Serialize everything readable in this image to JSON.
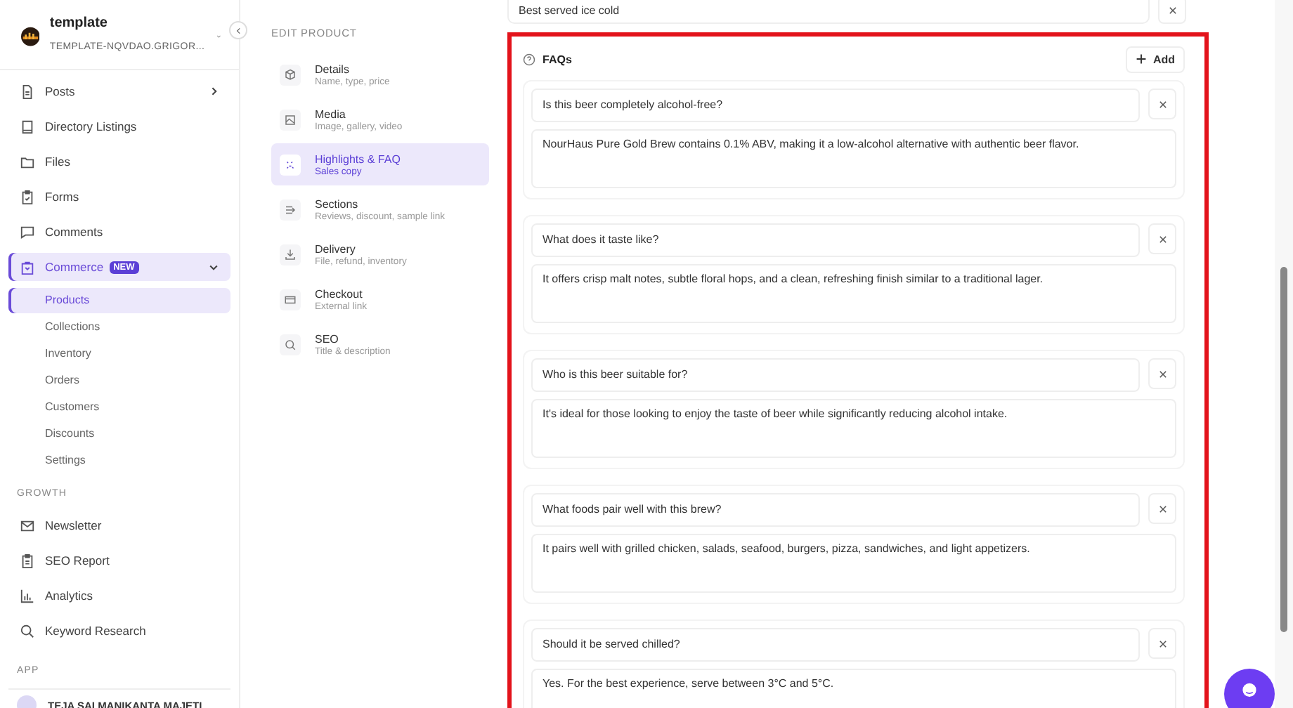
{
  "workspace": {
    "name": "template",
    "domain": "TEMPLATE-NQVDAO.GRIGOR..."
  },
  "sidebar": {
    "items": [
      {
        "label": "Posts",
        "selected": false,
        "expanded": false
      },
      {
        "label": "Directory Listings",
        "selected": false
      },
      {
        "label": "Files",
        "selected": false
      },
      {
        "label": "Forms",
        "selected": false
      },
      {
        "label": "Comments",
        "selected": false
      },
      {
        "label": "Commerce",
        "badge": "NEW",
        "selected": true,
        "expanded": true,
        "children": [
          {
            "label": "Products",
            "selected": true
          },
          {
            "label": "Collections",
            "selected": false
          },
          {
            "label": "Inventory",
            "selected": false
          },
          {
            "label": "Orders",
            "selected": false
          },
          {
            "label": "Customers",
            "selected": false
          },
          {
            "label": "Discounts",
            "selected": false
          },
          {
            "label": "Settings",
            "selected": false
          }
        ]
      }
    ],
    "growth": {
      "title": "GROWTH",
      "items": [
        {
          "label": "Newsletter",
          "selected": false
        },
        {
          "label": "SEO Report",
          "selected": false
        },
        {
          "label": "Analytics",
          "selected": false
        },
        {
          "label": "Keyword Research",
          "selected": false
        }
      ]
    },
    "app": {
      "title": "APP",
      "user": "TEJA SAI MANIKANTA MAJETI"
    }
  },
  "product_nav": {
    "title": "EDIT PRODUCT",
    "items": [
      {
        "label": "Details",
        "sublabel": "Name, type, price",
        "selected": false
      },
      {
        "label": "Media",
        "sublabel": "Image, gallery, video",
        "selected": false
      },
      {
        "label": "Highlights & FAQ",
        "sublabel": "Sales copy",
        "selected": true
      },
      {
        "label": "Sections",
        "sublabel": "Reviews, discount, sample link",
        "selected": false
      },
      {
        "label": "Delivery",
        "sublabel": "File, refund, inventory",
        "selected": false
      },
      {
        "label": "Checkout",
        "sublabel": "External link",
        "selected": false
      },
      {
        "label": "SEO",
        "sublabel": "Title & description",
        "selected": false
      }
    ]
  },
  "top_field": {
    "value": "Best served ice cold"
  },
  "faq": {
    "title": "FAQs",
    "add_label": "Add",
    "items": [
      {
        "question": "Is this beer completely alcohol-free?",
        "answer": "NourHaus Pure Gold Brew contains 0.1% ABV, making it a low-alcohol alternative with authentic beer flavor."
      },
      {
        "question": "What does it taste like?",
        "answer": "It offers crisp malt notes, subtle floral hops, and a clean, refreshing finish similar to a traditional lager."
      },
      {
        "question": "Who is this beer suitable for?",
        "answer": "It's ideal for those looking to enjoy the taste of beer while significantly reducing alcohol intake."
      },
      {
        "question": "What foods pair well with this brew?",
        "answer": "It pairs well with grilled chicken, salads, seafood, burgers, pizza, sandwiches, and light appetizers."
      },
      {
        "question": "Should it be served chilled?",
        "answer": "Yes. For the best experience, serve between 3°C and 5°C."
      }
    ]
  }
}
